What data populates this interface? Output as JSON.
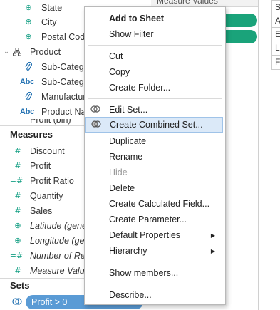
{
  "data_pane": {
    "dimensions": [
      {
        "label": "State",
        "icon": "globe-icon"
      },
      {
        "label": "City",
        "icon": "globe-icon"
      },
      {
        "label": "Postal Code",
        "icon": "globe-icon"
      },
      {
        "label": "Product",
        "icon": "hierarchy-icon",
        "expanded": true
      },
      {
        "label": "Sub-Category",
        "icon": "paperclip-icon"
      },
      {
        "label": "Sub-Category",
        "icon": "abc-icon"
      },
      {
        "label": "Manufacturer",
        "icon": "paperclip-icon"
      },
      {
        "label": "Product Name",
        "icon": "abc-icon"
      },
      {
        "label": "Profit (bin)",
        "icon": "bin-icon"
      }
    ],
    "measures_title": "Measures",
    "measures": [
      {
        "label": "Discount",
        "icon": "hash-icon",
        "italic": false
      },
      {
        "label": "Profit",
        "icon": "hash-icon",
        "italic": false
      },
      {
        "label": "Profit Ratio",
        "icon": "calc-hash-icon",
        "italic": false
      },
      {
        "label": "Quantity",
        "icon": "hash-icon",
        "italic": false
      },
      {
        "label": "Sales",
        "icon": "hash-icon",
        "italic": false
      },
      {
        "label": "Latitude (generated)",
        "icon": "globe-icon",
        "italic": true
      },
      {
        "label": "Longitude (generated)",
        "icon": "globe-icon",
        "italic": true
      },
      {
        "label": "Number of Records",
        "icon": "calc-hash-icon",
        "italic": true
      },
      {
        "label": "Measure Values",
        "icon": "hash-icon",
        "italic": true
      }
    ],
    "sets_title": "Sets",
    "sets": [
      {
        "label": "Profit > 0",
        "icon": "set-icon"
      }
    ]
  },
  "canvas": {
    "header_text": "Measure Values",
    "right_letters": [
      "S",
      "A",
      "E",
      "L",
      "F"
    ],
    "bar_color": "#1aa37a"
  },
  "context_menu": {
    "items": [
      {
        "label": "Add to Sheet",
        "bold": true
      },
      {
        "label": "Show Filter"
      },
      {
        "separator": true
      },
      {
        "label": "Cut"
      },
      {
        "label": "Copy"
      },
      {
        "label": "Create Folder..."
      },
      {
        "separator": true
      },
      {
        "label": "Edit Set...",
        "icon": "set-icon"
      },
      {
        "label": "Create Combined Set...",
        "icon": "combined-set-icon",
        "highlighted": true
      },
      {
        "label": "Duplicate"
      },
      {
        "label": "Rename"
      },
      {
        "label": "Hide",
        "disabled": true
      },
      {
        "label": "Delete"
      },
      {
        "label": "Create Calculated Field..."
      },
      {
        "label": "Create Parameter..."
      },
      {
        "label": "Default Properties",
        "submenu": true
      },
      {
        "label": "Hierarchy",
        "submenu": true
      },
      {
        "separator": true
      },
      {
        "label": "Show members..."
      },
      {
        "separator": true
      },
      {
        "label": "Describe..."
      }
    ]
  },
  "colors": {
    "accent_green": "#16a085",
    "set_pill": "#5a9bd5",
    "menu_highlight": "#dbe9f8"
  }
}
